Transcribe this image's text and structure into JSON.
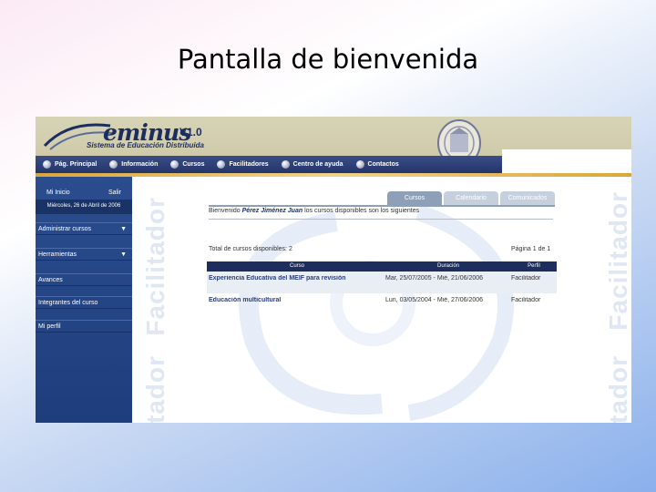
{
  "slide": {
    "title": "Pantalla de bienvenida"
  },
  "app": {
    "logo_word": "eminus",
    "logo_version": "V1.0",
    "logo_subtitle": "Sistema de Educación Distribuida"
  },
  "nav": {
    "items": [
      {
        "label": "Pág. Principal"
      },
      {
        "label": "Información"
      },
      {
        "label": "Cursos"
      },
      {
        "label": "Facilitadores"
      },
      {
        "label": "Centro de ayuda"
      },
      {
        "label": "Contactos"
      }
    ]
  },
  "sidebar": {
    "user": "Mi Inicio",
    "logout": "Salir",
    "date": "Miércoles, 26 de Abril de 2006",
    "menu": [
      {
        "label": "Administrar cursos",
        "arrow": "▼"
      },
      {
        "label": "Herramientas",
        "arrow": "▼"
      },
      {
        "label": "Avances",
        "arrow": ""
      },
      {
        "label": "Integrantes del curso",
        "arrow": ""
      },
      {
        "label": "Mi perfil",
        "arrow": ""
      }
    ]
  },
  "watermark": {
    "text": "Facilitador"
  },
  "content": {
    "tabs": [
      {
        "label": "Cursos",
        "active": true
      },
      {
        "label": "Calendario",
        "active": false
      },
      {
        "label": "Comunicados",
        "active": false
      }
    ],
    "welcome_prefix": "Bienvenido",
    "welcome_name": "Pérez Jiménez Juan",
    "welcome_suffix": "los cursos disponibles son los siguientes",
    "list_title": "Total de cursos disponibles: 2",
    "page_info": "Página 1 de 1",
    "table": {
      "headers": [
        "Curso",
        "Duración",
        "Perfil"
      ],
      "rows": [
        [
          "Experiencia Educativa del MEIF para revisión",
          "Mar, 25/07/2005 - Mié, 21/06/2006",
          "Facilitador"
        ],
        [
          "Educación multicultural",
          "Lun, 03/05/2004 - Mié, 27/06/2006",
          "Facilitador"
        ]
      ]
    }
  },
  "colors": {
    "header_bg": "#cbc7a4",
    "nav_bg": "#24356a",
    "sidebar_bg": "#2b4d8e",
    "accent_stripe": "#d9a63a",
    "table_head": "#1d2e5e"
  }
}
